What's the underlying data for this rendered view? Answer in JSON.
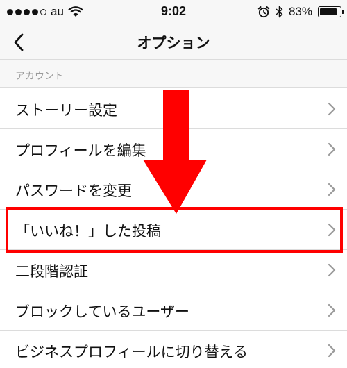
{
  "status_bar": {
    "carrier": "au",
    "time": "9:02",
    "battery": "83%",
    "icons": [
      "signal-dots-icon",
      "wifi-icon",
      "alarm-icon",
      "bluetooth-icon",
      "battery-icon"
    ]
  },
  "nav": {
    "back_icon": "chevron-left-icon",
    "title": "オプション"
  },
  "section": {
    "header": "アカウント"
  },
  "menu": {
    "items": [
      {
        "label": "ストーリー設定",
        "icon": "chevron-right-icon"
      },
      {
        "label": "プロフィールを編集",
        "icon": "chevron-right-icon"
      },
      {
        "label": "パスワードを変更",
        "icon": "chevron-right-icon"
      },
      {
        "label": "「いいね！」した投稿",
        "icon": "chevron-right-icon"
      },
      {
        "label": "二段階認証",
        "icon": "chevron-right-icon"
      },
      {
        "label": "ブロックしているユーザー",
        "icon": "chevron-right-icon"
      },
      {
        "label": "ビジネスプロフィールに切り替える",
        "icon": "chevron-right-icon"
      }
    ]
  },
  "annotation": {
    "highlight_color": "#ff0000",
    "highlighted_item": "「いいね！」した投稿",
    "arrow_icon": "down-arrow-icon"
  }
}
